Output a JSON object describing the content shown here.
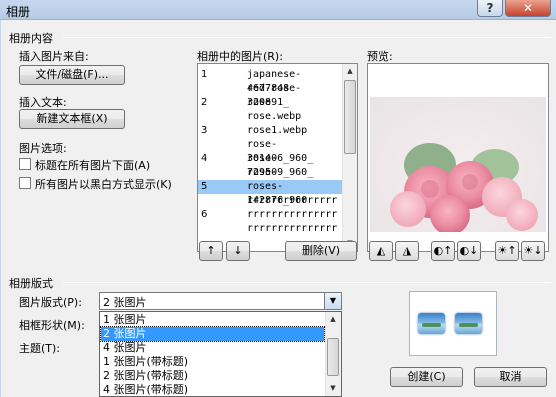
{
  "window": {
    "title": "相册",
    "help_label": "?",
    "close_label": "✕"
  },
  "album_content": {
    "group_title": "相册内容",
    "insert_picture_from": "插入图片来自:",
    "file_disk_button": "文件/磁盘(F)...",
    "insert_text": "插入文本:",
    "new_textbox_button": "新建文本框(X)",
    "picture_options": "图片选项:",
    "caption_below_all": "标题在所有图片下面(A)",
    "caption_below_checked": false,
    "all_black_white": "所有图片以黑白方式显示(K)",
    "all_black_white_checked": false
  },
  "pictures_in_album": {
    "label": "相册中的图片(R):",
    "rows": [
      {
        "num": "1",
        "name": "japanese-4677848"
      },
      {
        "num": "",
        "name": "red-rose-320891_"
      },
      {
        "num": "2",
        "name": "rose"
      },
      {
        "num": "",
        "name": "rose.webp"
      },
      {
        "num": "3",
        "name": "rose1.webp"
      },
      {
        "num": "",
        "name": "rose-301406_960_"
      },
      {
        "num": "4",
        "name": "rose-729509_960_"
      },
      {
        "num": "",
        "name": "rose-3802424_960"
      },
      {
        "num": "5",
        "name": "roses-142876_960"
      },
      {
        "num": "",
        "name": "rrrrrrrrrrrrrrr"
      },
      {
        "num": "6",
        "name": "rrrrrrrrrrrrrrr"
      },
      {
        "num": "",
        "name": "rrrrrrrrrrrrrrr"
      }
    ],
    "selected_index": 8,
    "move_up_label": "↑",
    "move_down_label": "↓",
    "delete_button": "删除(V)"
  },
  "preview": {
    "label": "预览:",
    "rotate_left_icon": "rotate-left-icon",
    "rotate_right_icon": "rotate-right-icon",
    "contrast_up_icon": "contrast-up-icon",
    "contrast_down_icon": "contrast-down-icon",
    "brightness_up_icon": "brightness-up-icon",
    "brightness_down_icon": "brightness-down-icon"
  },
  "album_layout": {
    "group_title": "相册版式",
    "picture_layout_label": "图片版式(P):",
    "picture_layout_value": "2 张图片",
    "frame_shape_label": "相框形状(M):",
    "theme_label": "主题(T):",
    "dropdown_options": [
      "1 张图片",
      "2 张图片",
      "4 张图片",
      "1 张图片(带标题)",
      "2 张图片(带标题)",
      "4 张图片(带标题)"
    ],
    "dropdown_selected_index": 1
  },
  "footer": {
    "create_button": "创建(C)",
    "cancel_button": "取消"
  },
  "colors": {
    "selection_listbox": "#99c9f5",
    "selection_dropdown": "#3399ff",
    "close_button": "#c8422a"
  }
}
